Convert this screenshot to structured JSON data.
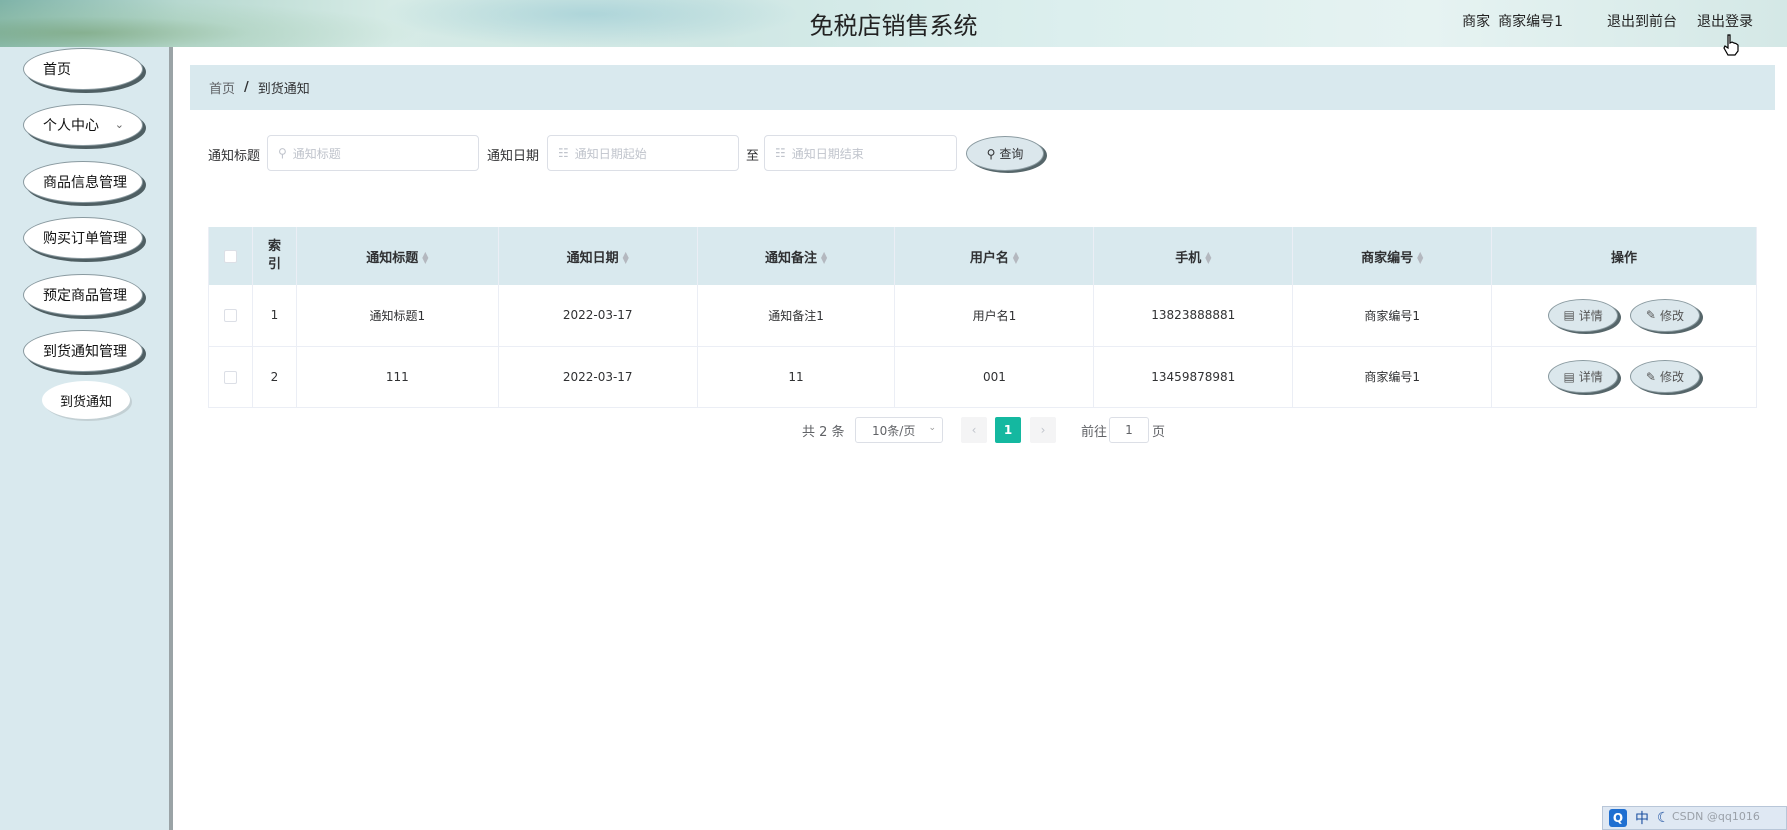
{
  "header": {
    "title": "免税店销售系统",
    "role": "商家",
    "username": "商家编号1",
    "to_front_label": "退出到前台",
    "logout_label": "退出登录"
  },
  "sidebar": {
    "items": [
      {
        "label": "首页"
      },
      {
        "label": "个人中心"
      },
      {
        "label": "商品信息管理"
      },
      {
        "label": "购买订单管理"
      },
      {
        "label": "预定商品管理"
      },
      {
        "label": "到货通知管理"
      }
    ],
    "sub_item": "到货通知"
  },
  "breadcrumb": {
    "home": "首页",
    "separator": "/",
    "current": "到货通知"
  },
  "search": {
    "title_label": "通知标题",
    "title_placeholder": "通知标题",
    "date_label": "通知日期",
    "date_start_placeholder": "通知日期起始",
    "date_to": "至",
    "date_end_placeholder": "通知日期结束",
    "query_label": "查询"
  },
  "table": {
    "columns": {
      "index": "索引",
      "title": "通知标题",
      "date": "通知日期",
      "note": "通知备注",
      "username": "用户名",
      "phone": "手机",
      "merchant": "商家编号",
      "ops": "操作"
    },
    "rows": [
      {
        "index": "1",
        "title": "通知标题1",
        "date": "2022-03-17",
        "note": "通知备注1",
        "username": "用户名1",
        "phone": "13823888881",
        "merchant": "商家编号1"
      },
      {
        "index": "2",
        "title": "111",
        "date": "2022-03-17",
        "note": "11",
        "username": "001",
        "phone": "13459878981",
        "merchant": "商家编号1"
      }
    ],
    "detail_label": "详情",
    "edit_label": "修改"
  },
  "pagination": {
    "total": "共 2 条",
    "page_size": "10条/页",
    "current_page": "1",
    "goto_label": "前往",
    "goto_value": "1",
    "page_suffix": "页"
  },
  "ime": {
    "q": "Q",
    "lang": "中"
  },
  "watermark": "CSDN @qq1016"
}
